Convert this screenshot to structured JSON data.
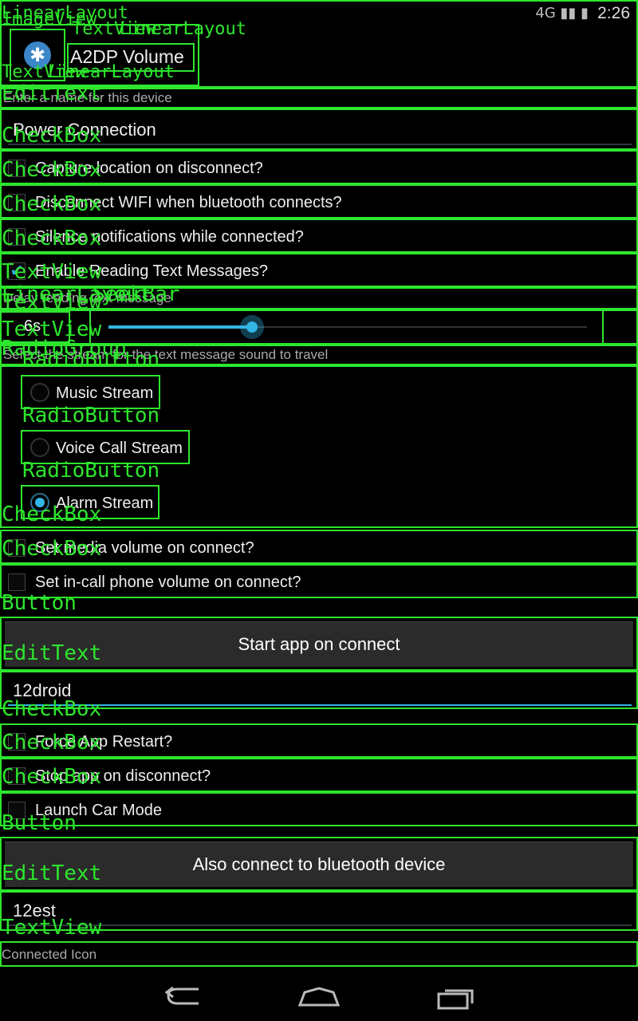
{
  "status_bar": {
    "network": "4G",
    "time": "2:26"
  },
  "header": {
    "title": "A2DP Volume",
    "icon": "bluetooth-icon"
  },
  "device_name": {
    "label": "Enter a name for this device",
    "value": "Power Connection"
  },
  "checkboxes": {
    "capture_location": "Capture location on disconnect?",
    "disconnect_wifi": "Disconnect WIFI when bluetooth connects?",
    "silence_notifications": "Silence notifications while connected?",
    "enable_reading": "Enable Reading Text Messages?"
  },
  "delay": {
    "label": "Delay reading text message",
    "value": "6s",
    "level": 0.3
  },
  "stream": {
    "label": "Select the stream for the text message sound to travel",
    "options": [
      "Music Stream",
      "Voice Call Stream",
      "Alarm Stream"
    ],
    "selected": "Alarm Stream"
  },
  "volume": {
    "media": "Set media volume on connect?",
    "in_call": "Set in-call phone volume on connect?"
  },
  "start_app": {
    "button": "Start app on connect",
    "value": "12droid"
  },
  "app_options": {
    "force_restart": "Force App Restart?",
    "stop_app": "Stop app on disconnect?",
    "car_mode": "Launch Car Mode"
  },
  "also_connect": {
    "button": "Also connect to bluetooth device",
    "value": "12est"
  },
  "connected_icon": {
    "label": "Connected Icon"
  },
  "overlay_labels": {
    "linear_layout": "LinearLayout",
    "frame_layout": "FrameLayout",
    "image_view": "ImageView",
    "text_view": "TextView",
    "relative_layout": "RelativeLayout",
    "edit_text": "EditText",
    "check_box": "CheckBox",
    "seek_bar": "SeekBar",
    "radio_group": "RadioGroup",
    "radio_button": "RadioButton",
    "button": "Button"
  },
  "colors": {
    "overlay_green": "#2de62d",
    "accent_blue": "#33b5e5",
    "background": "#000000"
  }
}
